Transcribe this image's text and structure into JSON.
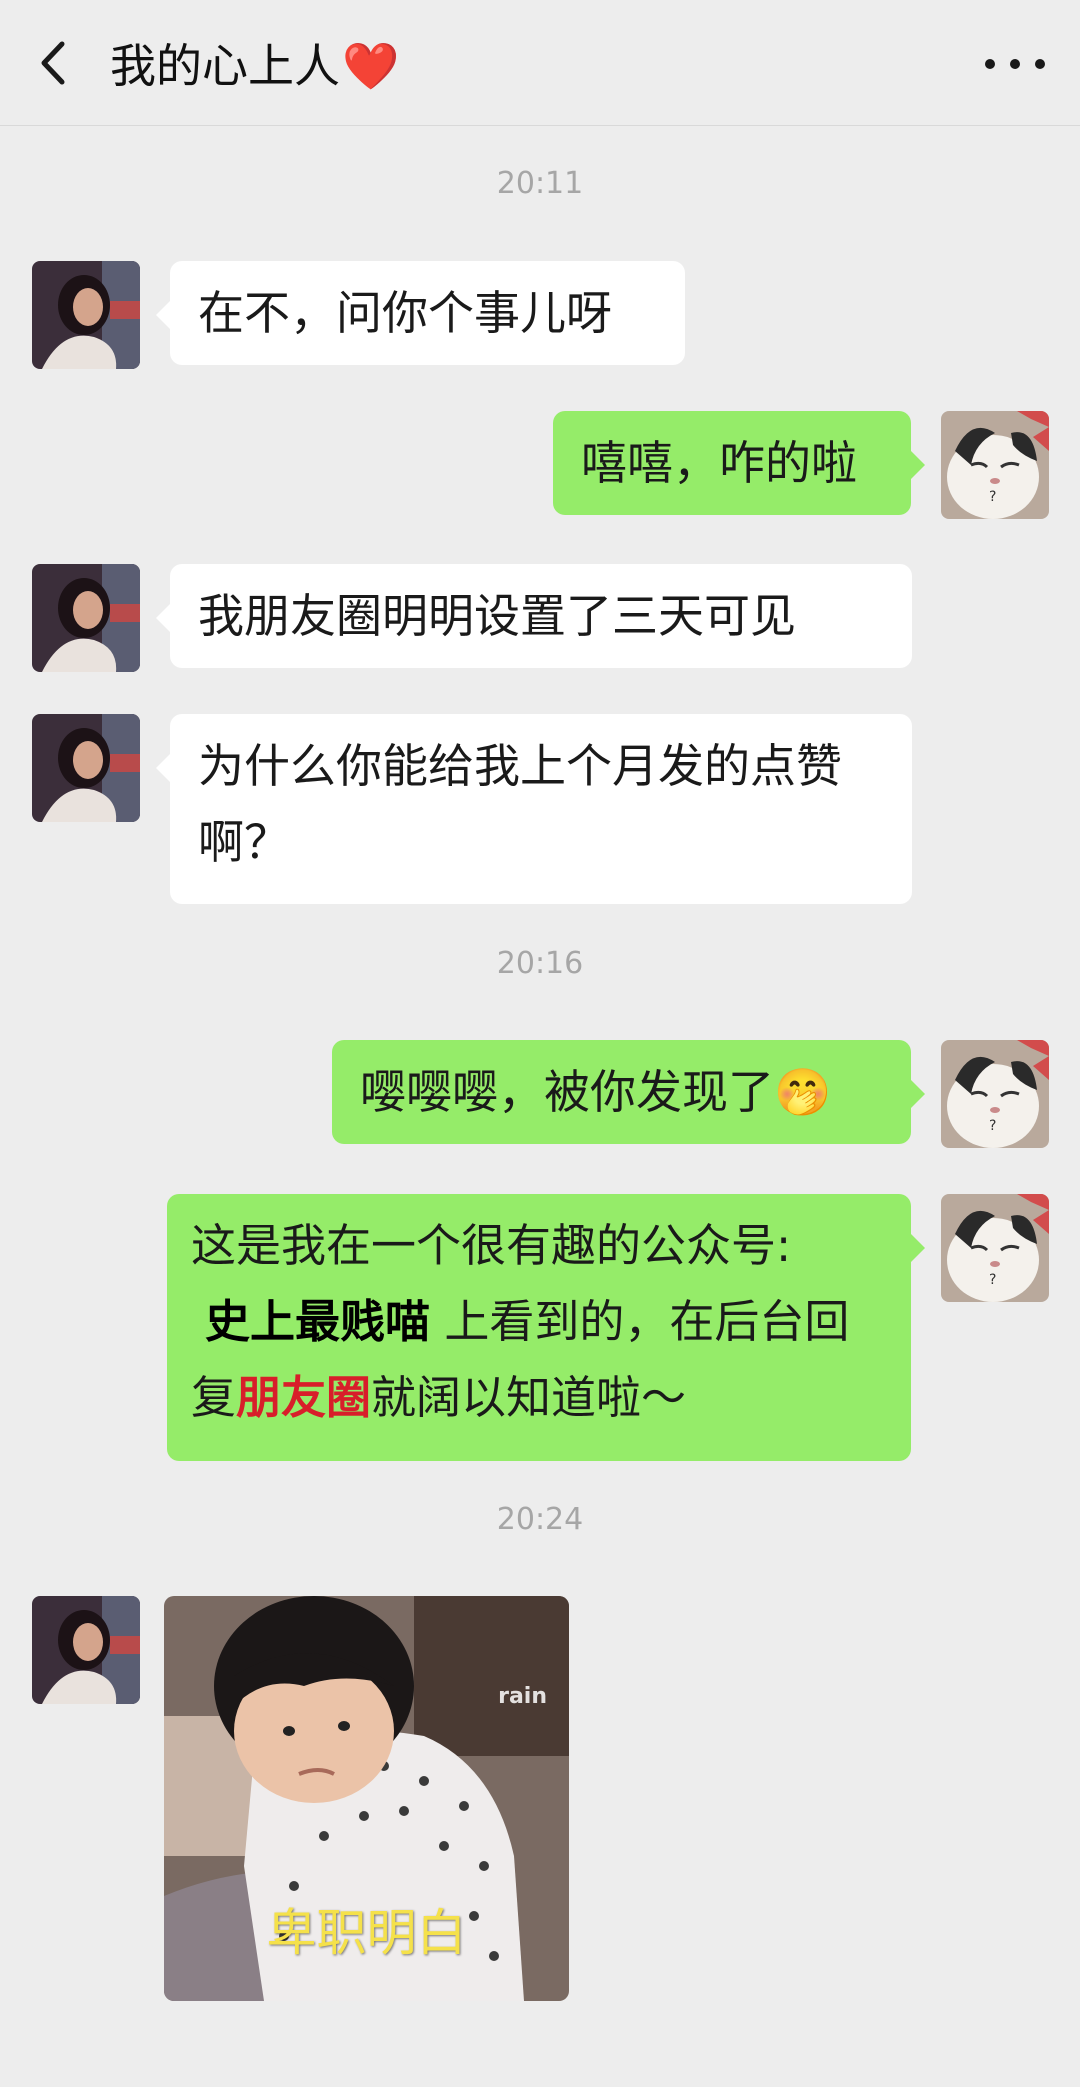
{
  "header": {
    "title": "我的心上人",
    "title_emoji": "❤️",
    "back_icon": "chevron-left-icon",
    "more_icon": "more-dots-icon"
  },
  "colors": {
    "background": "#ededed",
    "bubble_self": "#95ec69",
    "bubble_other": "#ffffff",
    "timestamp": "#a6a6a6",
    "highlight_red": "#d81e2a"
  },
  "messages": {
    "t1": "20:11",
    "m1": "在不，问你个事儿呀",
    "m2": "嘻嘻，咋的啦",
    "m3": "我朋友圈明明设置了三天可见",
    "m4": "为什么你能给我上个月发的点赞啊？",
    "t2": "20:16",
    "m5_text": "嘤嘤嘤，被你发现了",
    "m5_emoji": "🤭",
    "m6_part1": "这是我在一个很有趣的公众号:",
    "m6_account": "史上最贱喵",
    "m6_part2": "上看到的，在后台回复",
    "m6_keyword": "朋友圈",
    "m6_part3": "就阔以知道啦～",
    "t3": "20:24",
    "sticker_caption": "卑职明白",
    "sticker_watermark": "rain"
  }
}
